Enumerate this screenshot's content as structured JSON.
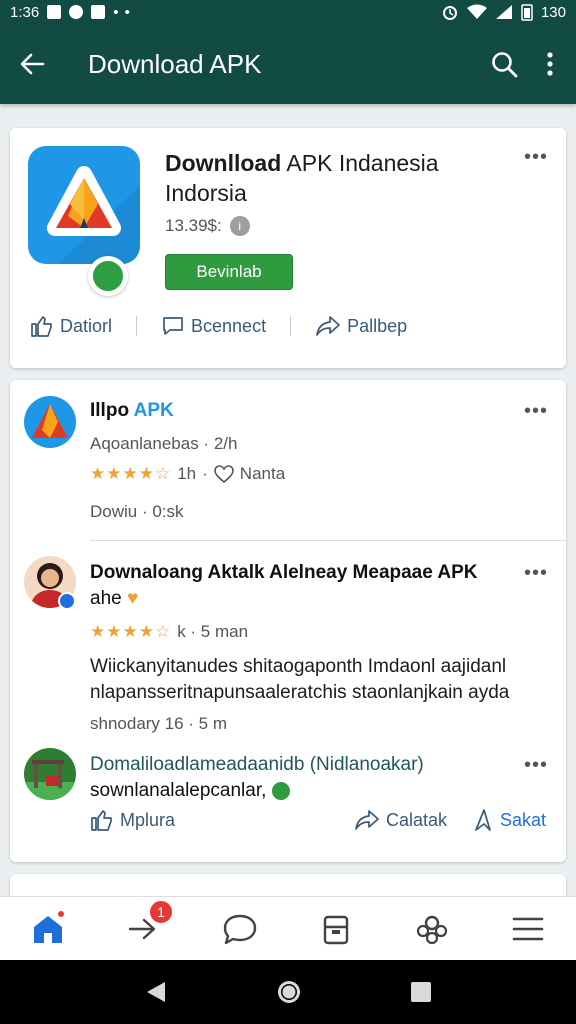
{
  "status_bar": {
    "time": "1:36",
    "battery": "130",
    "notif_dots": "• •"
  },
  "app_bar": {
    "title": "Download APK"
  },
  "app_card": {
    "title_bold": "Downlload",
    "title_rest": " APK Indanesia Indorsia",
    "size": "13.39$:",
    "download_label": "Bevinlab",
    "more": "•••",
    "actions": [
      {
        "label": "Datiorl"
      },
      {
        "label": "Bcennect"
      },
      {
        "label": "Pallbep"
      }
    ]
  },
  "post1": {
    "name_a": "Illpo",
    "name_b": " APK",
    "meta": "Aqoanlanebas · 2/h",
    "rating_count": "1h",
    "react": "Nanta",
    "footer": "Dowiu · 0:sk",
    "more": "•••"
  },
  "post2": {
    "title": "Downaloang Aktalk Alelneay Meapaae APK",
    "title_line2": "ahe",
    "meta_time": "k · 5 man",
    "body": "Wiickanyitanudes shitaogaponth Imdaonl aajidanl nlapansseritnapunsaaleratchis staonlanjkain ayda",
    "footer": "shnodary 16 · 5 m",
    "more": "•••"
  },
  "post3": {
    "title": "Domaliloadlameadaanidb (Nidlanoakar)",
    "subtitle": "sownlanalalepcanlar,",
    "more": "•••",
    "actions": [
      {
        "label": "Mplura"
      },
      {
        "label": "Calatak"
      },
      {
        "label": "Sakat"
      }
    ]
  },
  "bottom_nav": {
    "notif_count": "1"
  },
  "colors": {
    "primary": "#124a44",
    "accent": "#2f9a3e",
    "link": "#1f97e6",
    "star": "#f2a13a",
    "badge": "#e53935"
  }
}
